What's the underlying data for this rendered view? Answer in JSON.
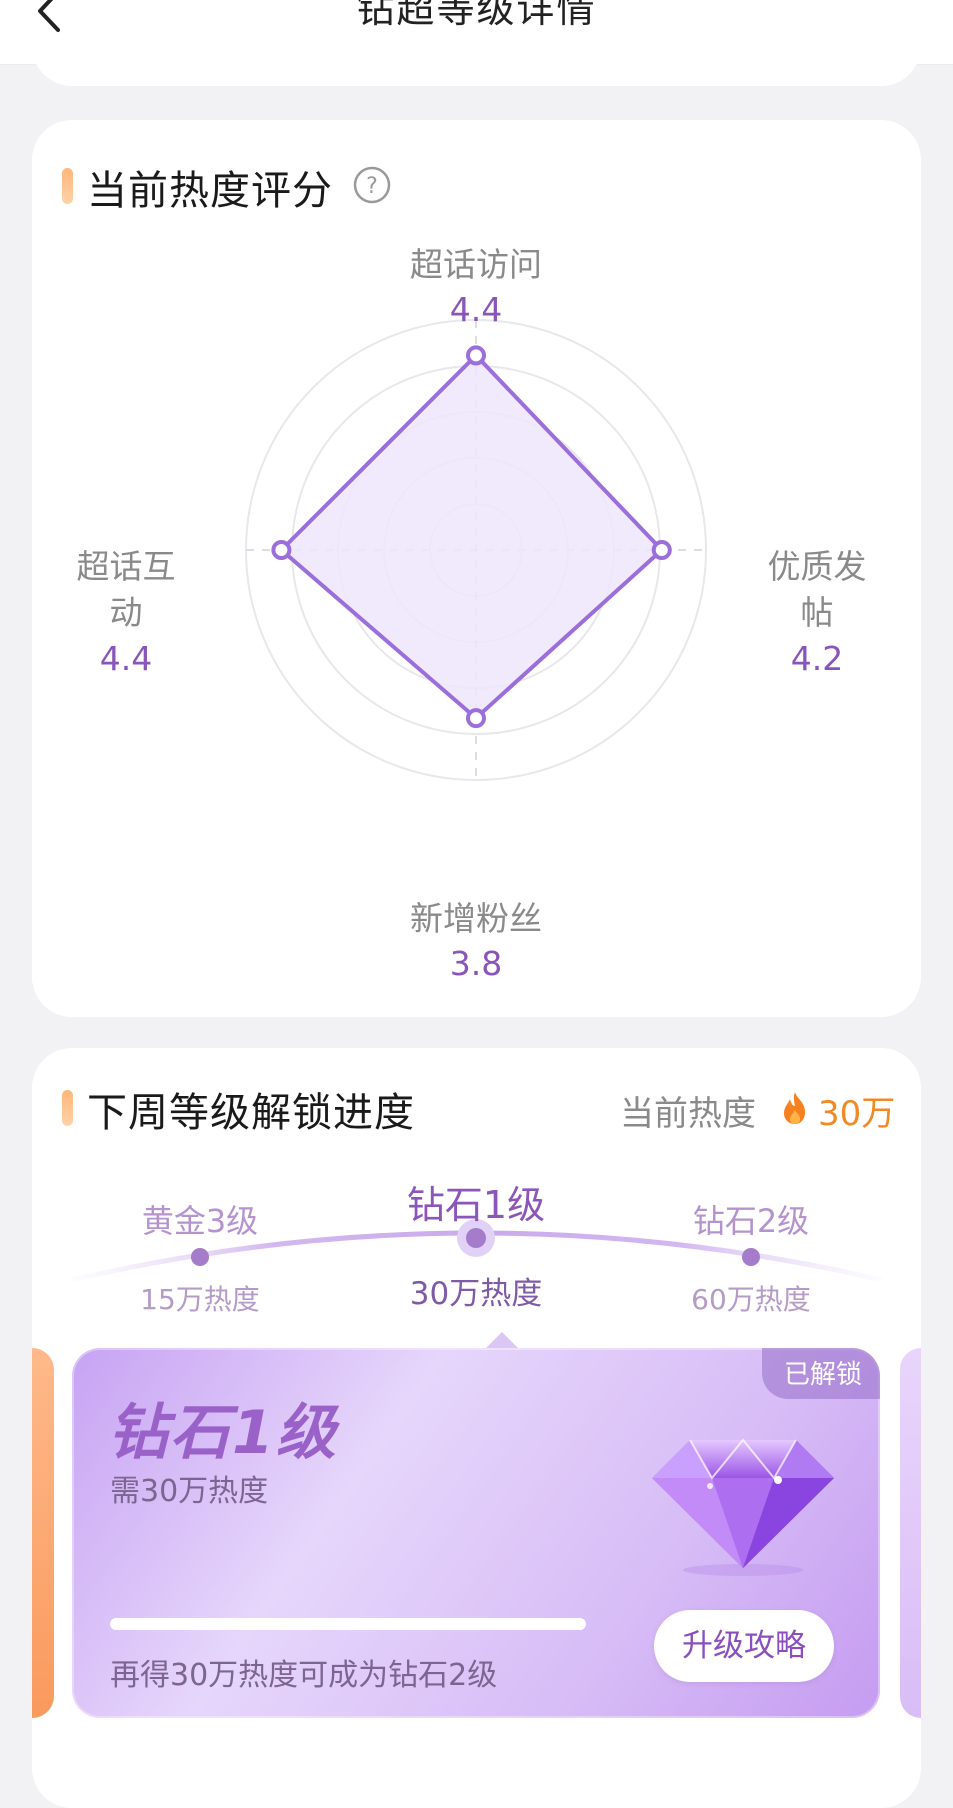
{
  "header": {
    "title": "钻超等级详情"
  },
  "radar": {
    "title": "当前热度评分",
    "axes": [
      {
        "label": "超话访问",
        "value": "4.4",
        "score": 4.4
      },
      {
        "label": "优质发帖",
        "value": "4.2",
        "score": 4.2
      },
      {
        "label": "新增粉丝",
        "value": "3.8",
        "score": 3.8
      },
      {
        "label": "超话互动",
        "value": "4.4",
        "score": 4.4
      }
    ],
    "colors": {
      "line": "#9b6fdb",
      "fill": "#efe6fb",
      "grid": "#e8e8ec"
    }
  },
  "levels": {
    "title": "下周等级解锁进度",
    "heat_label": "当前热度",
    "heat_value": "30万",
    "track": [
      {
        "name": "黄金3级",
        "req": "15万热度"
      },
      {
        "name": "钻石1级",
        "req": "30万热度"
      },
      {
        "name": "钻石2级",
        "req": "60万热度"
      }
    ],
    "card": {
      "badge": "已解锁",
      "level": "钻石1级",
      "need": "需30万热度",
      "progress": 1.0,
      "hint": "再得30万热度可成为钻石2级",
      "button": "升级攻略"
    },
    "colors": {
      "accent": "#8b55b9",
      "heat": "#f08a26"
    }
  }
}
